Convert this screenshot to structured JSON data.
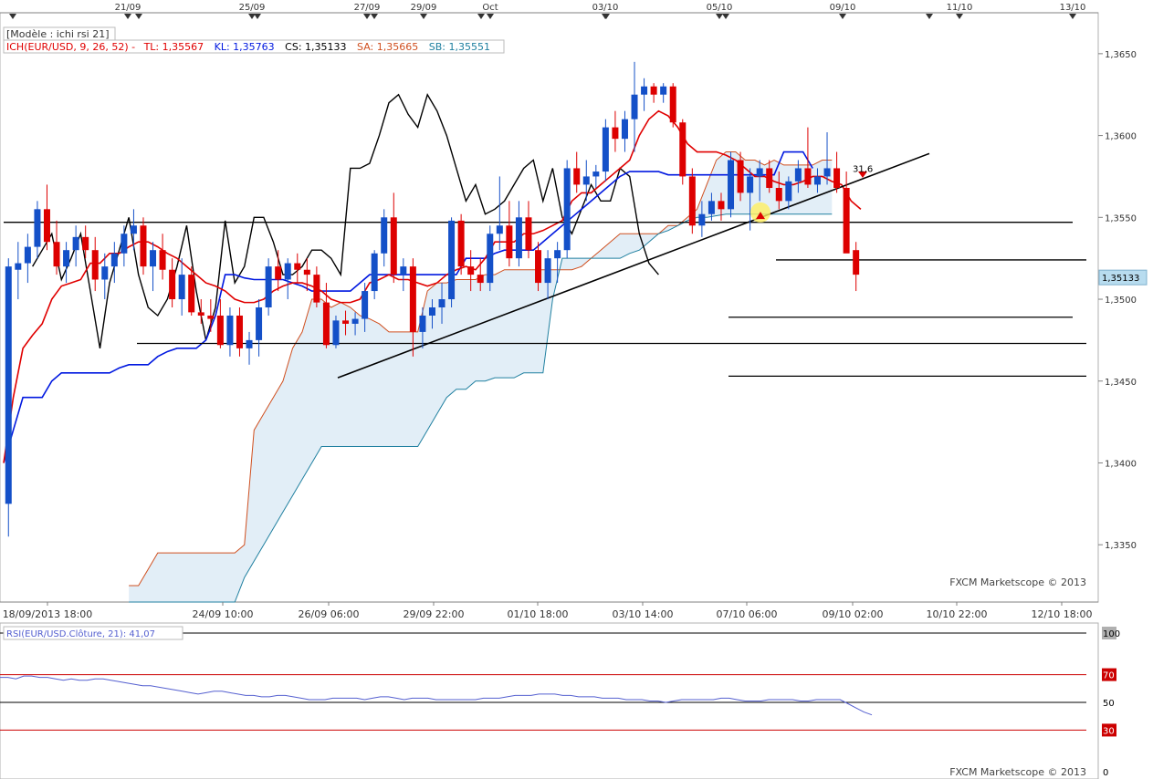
{
  "header": {
    "template": "[Modèle : ichi rsi 21]",
    "indicator": "ICH(EUR/USD, 9, 26, 52) -",
    "tl": "TL: 1,35567",
    "kl": "KL: 1,35763",
    "cs": "CS: 1,35133",
    "sa": "SA: 1,35665",
    "sb": "SB: 1,35551"
  },
  "watermark": "FXCM Marketscope © 2013",
  "rsi_header": "RSI(EUR/USD.Clôture, 21): 41,07",
  "current_price": "1,35133",
  "annotation": "31,6",
  "top_dates": [
    "21/09",
    "25/09",
    "27/09",
    "29/09",
    "Oct",
    "03/10",
    "05/10",
    "09/10",
    "11/10",
    "13/10"
  ],
  "bottom_dates": [
    "18/09/2013 18:00",
    "24/09 10:00",
    "26/09 06:00",
    "29/09 22:00",
    "01/10 18:00",
    "03/10 14:00",
    "07/10 06:00",
    "09/10 02:00",
    "10/10 22:00",
    "12/10 18:00"
  ],
  "price_ticks": [
    "1,3650",
    "1,3600",
    "1,3550",
    "1,3500",
    "1,3450",
    "1,3400",
    "1,3350"
  ],
  "rsi_ticks": [
    "100",
    "70",
    "50",
    "30",
    "0"
  ],
  "colors": {
    "bull": "#1450c8",
    "bear": "#dd0000",
    "tenkan": "#e00000",
    "kijun": "#0018e0",
    "chikou": "#000000",
    "span_a": "#d05020",
    "span_b": "#2080a0",
    "cloud": "#e2eef7",
    "rsi": "#5560d0",
    "rsi_level": "#cc0000",
    "badge": "#b8dcef"
  },
  "chart_data": {
    "type": "candlestick",
    "instrument": "EUR/USD",
    "ylim": [
      1.3315,
      1.3675
    ],
    "candles": [
      [
        1.3375,
        1.3525,
        1.3355,
        1.352
      ],
      [
        1.3518,
        1.3535,
        1.35,
        1.3522
      ],
      [
        1.3522,
        1.354,
        1.351,
        1.3532
      ],
      [
        1.3532,
        1.356,
        1.3525,
        1.3555
      ],
      [
        1.3555,
        1.357,
        1.353,
        1.3535
      ],
      [
        1.3535,
        1.3548,
        1.3515,
        1.352
      ],
      [
        1.352,
        1.3535,
        1.351,
        1.353
      ],
      [
        1.353,
        1.3545,
        1.352,
        1.3538
      ],
      [
        1.3538,
        1.3545,
        1.3525,
        1.353
      ],
      [
        1.353,
        1.3538,
        1.3505,
        1.3512
      ],
      [
        1.3512,
        1.3528,
        1.35,
        1.352
      ],
      [
        1.352,
        1.3535,
        1.351,
        1.3528
      ],
      [
        1.3528,
        1.3545,
        1.352,
        1.354
      ],
      [
        1.354,
        1.3555,
        1.353,
        1.3545
      ],
      [
        1.3545,
        1.355,
        1.3515,
        1.352
      ],
      [
        1.352,
        1.3535,
        1.3505,
        1.353
      ],
      [
        1.353,
        1.354,
        1.3512,
        1.3518
      ],
      [
        1.3518,
        1.3525,
        1.3495,
        1.35
      ],
      [
        1.35,
        1.3525,
        1.349,
        1.3515
      ],
      [
        1.3515,
        1.352,
        1.349,
        1.3492
      ],
      [
        1.3492,
        1.35,
        1.3485,
        1.349
      ],
      [
        1.349,
        1.35,
        1.348,
        1.3488
      ],
      [
        1.349,
        1.35,
        1.347,
        1.3472
      ],
      [
        1.3472,
        1.3495,
        1.3465,
        1.349
      ],
      [
        1.349,
        1.3495,
        1.3465,
        1.347
      ],
      [
        1.347,
        1.348,
        1.346,
        1.3475
      ],
      [
        1.3475,
        1.35,
        1.3465,
        1.3495
      ],
      [
        1.3495,
        1.3525,
        1.349,
        1.352
      ],
      [
        1.352,
        1.353,
        1.3505,
        1.3512
      ],
      [
        1.3512,
        1.3525,
        1.35,
        1.3522
      ],
      [
        1.3522,
        1.3528,
        1.351,
        1.3518
      ],
      [
        1.3518,
        1.3525,
        1.3505,
        1.3515
      ],
      [
        1.3515,
        1.352,
        1.3495,
        1.3498
      ],
      [
        1.3498,
        1.351,
        1.347,
        1.3472
      ],
      [
        1.3472,
        1.349,
        1.347,
        1.3487
      ],
      [
        1.3487,
        1.3493,
        1.3478,
        1.3485
      ],
      [
        1.3485,
        1.3492,
        1.3478,
        1.3488
      ],
      [
        1.3488,
        1.351,
        1.348,
        1.3505
      ],
      [
        1.3505,
        1.353,
        1.35,
        1.3528
      ],
      [
        1.3528,
        1.3555,
        1.352,
        1.355
      ],
      [
        1.355,
        1.3565,
        1.351,
        1.3515
      ],
      [
        1.3515,
        1.3525,
        1.3505,
        1.352
      ],
      [
        1.352,
        1.3525,
        1.3465,
        1.348
      ],
      [
        1.348,
        1.3495,
        1.347,
        1.349
      ],
      [
        1.349,
        1.35,
        1.3482,
        1.3495
      ],
      [
        1.3495,
        1.351,
        1.3485,
        1.35
      ],
      [
        1.35,
        1.355,
        1.3495,
        1.3548
      ],
      [
        1.3548,
        1.3552,
        1.3515,
        1.352
      ],
      [
        1.352,
        1.353,
        1.3505,
        1.3515
      ],
      [
        1.3515,
        1.3525,
        1.3505,
        1.351
      ],
      [
        1.351,
        1.3545,
        1.3505,
        1.354
      ],
      [
        1.354,
        1.3575,
        1.353,
        1.3545
      ],
      [
        1.3545,
        1.356,
        1.352,
        1.3525
      ],
      [
        1.3525,
        1.356,
        1.352,
        1.355
      ],
      [
        1.355,
        1.356,
        1.3525,
        1.353
      ],
      [
        1.353,
        1.3535,
        1.3505,
        1.351
      ],
      [
        1.351,
        1.353,
        1.35,
        1.3525
      ],
      [
        1.3525,
        1.3535,
        1.351,
        1.353
      ],
      [
        1.353,
        1.3585,
        1.3525,
        1.358
      ],
      [
        1.358,
        1.359,
        1.3565,
        1.357
      ],
      [
        1.357,
        1.3585,
        1.356,
        1.3575
      ],
      [
        1.3575,
        1.3582,
        1.3568,
        1.3578
      ],
      [
        1.3578,
        1.361,
        1.3572,
        1.3605
      ],
      [
        1.3605,
        1.3615,
        1.359,
        1.3598
      ],
      [
        1.3598,
        1.3615,
        1.359,
        1.361
      ],
      [
        1.361,
        1.3645,
        1.359,
        1.3625
      ],
      [
        1.3625,
        1.3635,
        1.3615,
        1.363
      ],
      [
        1.363,
        1.3632,
        1.362,
        1.3625
      ],
      [
        1.3625,
        1.3632,
        1.362,
        1.363
      ],
      [
        1.363,
        1.3632,
        1.3605,
        1.3608
      ],
      [
        1.3608,
        1.361,
        1.357,
        1.3575
      ],
      [
        1.3575,
        1.358,
        1.354,
        1.3545
      ],
      [
        1.3545,
        1.356,
        1.3538,
        1.3552
      ],
      [
        1.3552,
        1.3565,
        1.3548,
        1.356
      ],
      [
        1.356,
        1.3565,
        1.3548,
        1.3555
      ],
      [
        1.3555,
        1.359,
        1.355,
        1.3585
      ],
      [
        1.3585,
        1.359,
        1.356,
        1.3565
      ],
      [
        1.3565,
        1.358,
        1.3542,
        1.3575
      ],
      [
        1.3575,
        1.3585,
        1.356,
        1.358
      ],
      [
        1.358,
        1.3585,
        1.3565,
        1.3568
      ],
      [
        1.3568,
        1.3578,
        1.3555,
        1.356
      ],
      [
        1.356,
        1.3575,
        1.3555,
        1.3572
      ],
      [
        1.3572,
        1.3585,
        1.3565,
        1.358
      ],
      [
        1.358,
        1.3605,
        1.3568,
        1.357
      ],
      [
        1.357,
        1.358,
        1.3565,
        1.3575
      ],
      [
        1.3575,
        1.3602,
        1.357,
        1.358
      ],
      [
        1.358,
        1.359,
        1.3565,
        1.3568
      ],
      [
        1.3568,
        1.3578,
        1.3542,
        1.3528
      ],
      [
        1.353,
        1.3535,
        1.3505,
        1.3515
      ]
    ],
    "tenkan_sen": [
      1.34,
      1.344,
      1.347,
      1.3478,
      1.3485,
      1.35,
      1.3508,
      1.351,
      1.3512,
      1.3522,
      1.3522,
      1.3528,
      1.3528,
      1.3532,
      1.3535,
      1.3535,
      1.3532,
      1.3528,
      1.3525,
      1.352,
      1.3515,
      1.351,
      1.3508,
      1.3505,
      1.35,
      1.3498,
      1.3498,
      1.35,
      1.3505,
      1.3508,
      1.351,
      1.351,
      1.3508,
      1.3505,
      1.35,
      1.3498,
      1.3498,
      1.35,
      1.351,
      1.3512,
      1.3515,
      1.3512,
      1.3512,
      1.351,
      1.3508,
      1.351,
      1.3515,
      1.3518,
      1.352,
      1.3518,
      1.3525,
      1.3535,
      1.3535,
      1.3535,
      1.354,
      1.354,
      1.3542,
      1.3545,
      1.3548,
      1.356,
      1.3565,
      1.3565,
      1.357,
      1.3575,
      1.358,
      1.3585,
      1.36,
      1.361,
      1.3615,
      1.3612,
      1.3605,
      1.3595,
      1.359,
      1.359,
      1.359,
      1.3588,
      1.3585,
      1.358,
      1.3575,
      1.3575,
      1.3572,
      1.357,
      1.357,
      1.3572,
      1.3575,
      1.3575,
      1.3572,
      1.357,
      1.356,
      1.3555
    ],
    "kijun_sen": [
      1.34,
      1.342,
      1.344,
      1.344,
      1.344,
      1.345,
      1.3455,
      1.3455,
      1.3455,
      1.3455,
      1.3455,
      1.3455,
      1.3458,
      1.346,
      1.346,
      1.346,
      1.3465,
      1.3468,
      1.347,
      1.347,
      1.347,
      1.3475,
      1.349,
      1.3515,
      1.3515,
      1.3513,
      1.3512,
      1.3512,
      1.3512,
      1.3512,
      1.351,
      1.3508,
      1.3505,
      1.3505,
      1.3505,
      1.3505,
      1.3505,
      1.351,
      1.3515,
      1.3515,
      1.3515,
      1.3515,
      1.3515,
      1.3515,
      1.3515,
      1.3515,
      1.3515,
      1.3515,
      1.3525,
      1.3525,
      1.3525,
      1.3528,
      1.353,
      1.353,
      1.353,
      1.353,
      1.3535,
      1.354,
      1.3545,
      1.355,
      1.3555,
      1.356,
      1.3565,
      1.357,
      1.3575,
      1.3578,
      1.3578,
      1.3578,
      1.3578,
      1.3576,
      1.3576,
      1.3576,
      1.3576,
      1.3576,
      1.3576,
      1.3576,
      1.3576,
      1.3576,
      1.3576,
      1.3576,
      1.3576,
      1.359,
      1.359,
      1.359,
      1.358
    ],
    "chikou_span": [
      1.352,
      1.353,
      1.354,
      1.3512,
      1.3525,
      1.354,
      1.3505,
      1.347,
      1.351,
      1.353,
      1.355,
      1.3515,
      1.3495,
      1.349,
      1.35,
      1.352,
      1.3545,
      1.3505,
      1.3475,
      1.3495,
      1.3548,
      1.351,
      1.352,
      1.355,
      1.355,
      1.3535,
      1.3515,
      1.3515,
      1.352,
      1.353,
      1.353,
      1.3525,
      1.3515,
      1.358,
      1.358,
      1.3583,
      1.36,
      1.362,
      1.3625,
      1.3613,
      1.3605,
      1.3625,
      1.3615,
      1.36,
      1.358,
      1.356,
      1.357,
      1.3552,
      1.3555,
      1.356,
      1.357,
      1.358,
      1.3585,
      1.356,
      1.358,
      1.355,
      1.354,
      1.3555,
      1.357,
      1.356,
      1.356,
      1.358,
      1.3575,
      1.354,
      1.3522,
      1.3515
    ],
    "senkou_span_a": [
      1.3325,
      1.3325,
      1.3335,
      1.3345,
      1.3345,
      1.3345,
      1.3345,
      1.3345,
      1.3345,
      1.3345,
      1.3345,
      1.3345,
      1.335,
      1.342,
      1.343,
      1.344,
      1.345,
      1.347,
      1.348,
      1.35,
      1.35,
      1.3495,
      1.3498,
      1.3495,
      1.349,
      1.3488,
      1.3485,
      1.348,
      1.348,
      1.348,
      1.348,
      1.3505,
      1.351,
      1.351,
      1.3512,
      1.3512,
      1.3512,
      1.3515,
      1.3515,
      1.3518,
      1.3518,
      1.3518,
      1.3518,
      1.3518,
      1.3518,
      1.3518,
      1.3518,
      1.352,
      1.3525,
      1.353,
      1.3535,
      1.354,
      1.354,
      1.354,
      1.354,
      1.354,
      1.3545,
      1.3545,
      1.355,
      1.3555,
      1.357,
      1.3585,
      1.359,
      1.359,
      1.3585,
      1.3585,
      1.3582,
      1.3585,
      1.3582,
      1.3582,
      1.3582,
      1.3582,
      1.3585,
      1.3585
    ],
    "senkou_span_b": [
      1.3315,
      1.3315,
      1.3315,
      1.3315,
      1.3315,
      1.3315,
      1.3315,
      1.3315,
      1.3315,
      1.3315,
      1.3315,
      1.3315,
      1.333,
      1.334,
      1.335,
      1.336,
      1.337,
      1.338,
      1.339,
      1.34,
      1.341,
      1.341,
      1.341,
      1.341,
      1.341,
      1.341,
      1.341,
      1.341,
      1.341,
      1.341,
      1.341,
      1.342,
      1.343,
      1.344,
      1.3445,
      1.3445,
      1.345,
      1.345,
      1.3452,
      1.3452,
      1.3452,
      1.3455,
      1.3455,
      1.3455,
      1.35,
      1.3525,
      1.3525,
      1.3525,
      1.3525,
      1.3525,
      1.3525,
      1.3525,
      1.3528,
      1.353,
      1.3535,
      1.354,
      1.3542,
      1.3545,
      1.3548,
      1.355,
      1.355,
      1.3551,
      1.3552,
      1.3552,
      1.3552,
      1.3552,
      1.3552,
      1.3552,
      1.3552,
      1.3552,
      1.3552,
      1.3552,
      1.3552,
      1.3552
    ],
    "horizontal_levels": [
      1.3547,
      1.3524,
      1.3489,
      1.3473,
      1.3453
    ],
    "trendline": [
      [
        1.3452,
        1.3589
      ]
    ],
    "rsi": {
      "period": 21,
      "levels": [
        70,
        50,
        30
      ],
      "ylim": [
        0,
        100
      ],
      "values": [
        68,
        68,
        67,
        69,
        69,
        68,
        68,
        67,
        66,
        67,
        66,
        66,
        67,
        67,
        66,
        65,
        64,
        63,
        62,
        62,
        61,
        60,
        59,
        58,
        57,
        56,
        57,
        58,
        58,
        57,
        56,
        55,
        55,
        54,
        54,
        55,
        55,
        54,
        53,
        52,
        52,
        52,
        53,
        53,
        53,
        53,
        52,
        53,
        54,
        54,
        53,
        52,
        53,
        53,
        53,
        52,
        52,
        52,
        52,
        52,
        52,
        53,
        53,
        53,
        54,
        55,
        55,
        55,
        56,
        56,
        56,
        55,
        55,
        54,
        54,
        54,
        53,
        53,
        53,
        52,
        52,
        52,
        51,
        51,
        50,
        51,
        52,
        52,
        52,
        52,
        52,
        53,
        53,
        52,
        51,
        51,
        51,
        52,
        52,
        52,
        52,
        51,
        51,
        52,
        52,
        52,
        52,
        49,
        46,
        43,
        41
      ]
    }
  }
}
